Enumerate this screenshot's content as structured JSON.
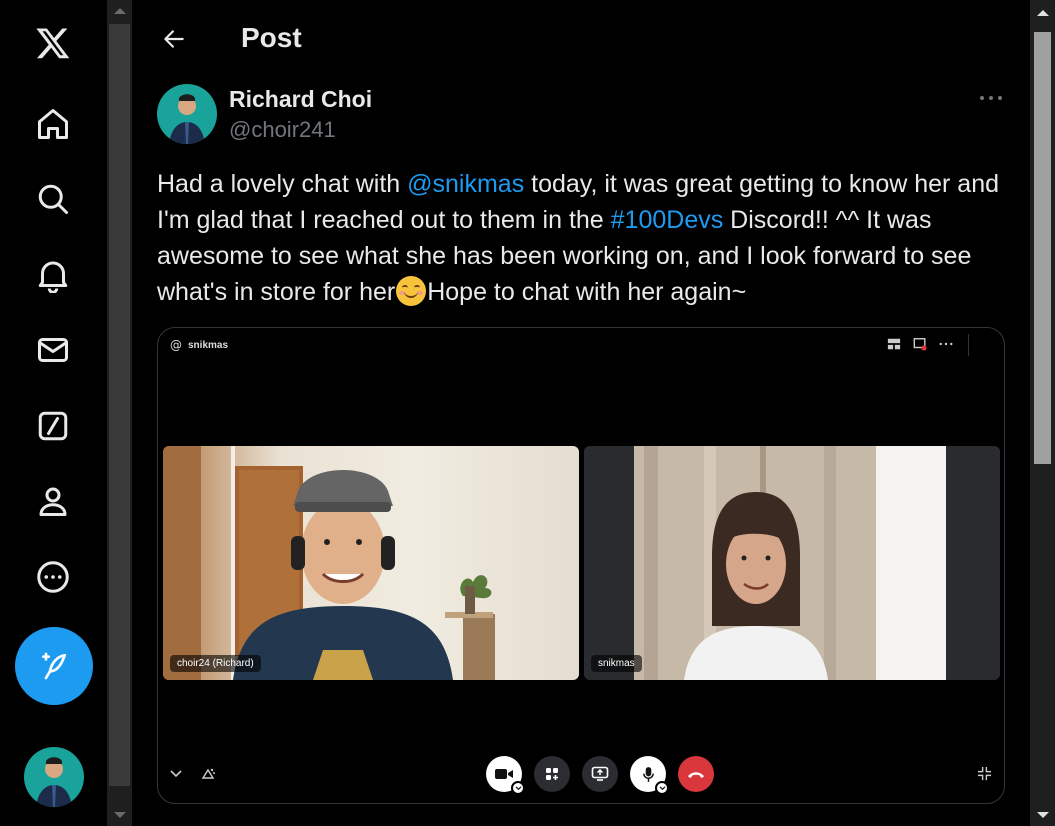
{
  "nav": {
    "items": [
      {
        "name": "x-logo-icon"
      },
      {
        "name": "home-icon"
      },
      {
        "name": "search-icon"
      },
      {
        "name": "notifications-icon"
      },
      {
        "name": "messages-icon"
      },
      {
        "name": "grok-icon"
      },
      {
        "name": "profile-icon"
      },
      {
        "name": "more-icon"
      }
    ],
    "compose_color": "#1d9bf0"
  },
  "header": {
    "title": "Post"
  },
  "post": {
    "author_name": "Richard Choi",
    "author_handle": "@choir241",
    "text": {
      "part1": "Had a lovely chat with ",
      "mention": "@snikmas",
      "part2": " today, it was great getting to know her and I'm glad that I reached out to them in the ",
      "hashtag": "#100Devs",
      "part3": " Discord!! ^^ It was awesome to see what she has been working on, and I look forward to see what's in store for her",
      "part4": "Hope to chat with her again~"
    },
    "media": {
      "call_user": "snikmas",
      "participants": [
        {
          "label": "choir24 (Richard)"
        },
        {
          "label": "snikmas"
        }
      ]
    }
  },
  "colors": {
    "accent": "#1d9bf0",
    "text": "#e7e9ea",
    "muted": "#71767b",
    "hangup": "#da373c"
  }
}
